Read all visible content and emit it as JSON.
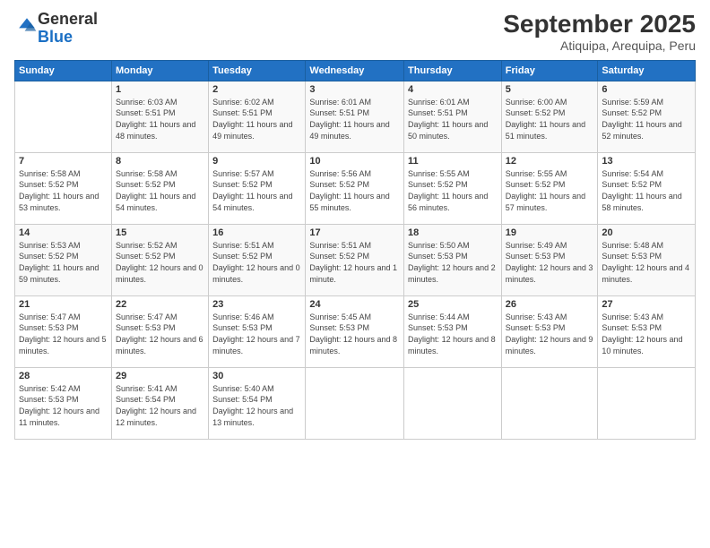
{
  "header": {
    "logo_general": "General",
    "logo_blue": "Blue",
    "title": "September 2025",
    "subtitle": "Atiquipa, Arequipa, Peru"
  },
  "weekdays": [
    "Sunday",
    "Monday",
    "Tuesday",
    "Wednesday",
    "Thursday",
    "Friday",
    "Saturday"
  ],
  "weeks": [
    [
      {
        "day": "",
        "sunrise": "",
        "sunset": "",
        "daylight": ""
      },
      {
        "day": "1",
        "sunrise": "6:03 AM",
        "sunset": "5:51 PM",
        "daylight": "11 hours and 48 minutes."
      },
      {
        "day": "2",
        "sunrise": "6:02 AM",
        "sunset": "5:51 PM",
        "daylight": "11 hours and 49 minutes."
      },
      {
        "day": "3",
        "sunrise": "6:01 AM",
        "sunset": "5:51 PM",
        "daylight": "11 hours and 49 minutes."
      },
      {
        "day": "4",
        "sunrise": "6:01 AM",
        "sunset": "5:51 PM",
        "daylight": "11 hours and 50 minutes."
      },
      {
        "day": "5",
        "sunrise": "6:00 AM",
        "sunset": "5:52 PM",
        "daylight": "11 hours and 51 minutes."
      },
      {
        "day": "6",
        "sunrise": "5:59 AM",
        "sunset": "5:52 PM",
        "daylight": "11 hours and 52 minutes."
      }
    ],
    [
      {
        "day": "7",
        "sunrise": "5:58 AM",
        "sunset": "5:52 PM",
        "daylight": "11 hours and 53 minutes."
      },
      {
        "day": "8",
        "sunrise": "5:58 AM",
        "sunset": "5:52 PM",
        "daylight": "11 hours and 54 minutes."
      },
      {
        "day": "9",
        "sunrise": "5:57 AM",
        "sunset": "5:52 PM",
        "daylight": "11 hours and 54 minutes."
      },
      {
        "day": "10",
        "sunrise": "5:56 AM",
        "sunset": "5:52 PM",
        "daylight": "11 hours and 55 minutes."
      },
      {
        "day": "11",
        "sunrise": "5:55 AM",
        "sunset": "5:52 PM",
        "daylight": "11 hours and 56 minutes."
      },
      {
        "day": "12",
        "sunrise": "5:55 AM",
        "sunset": "5:52 PM",
        "daylight": "11 hours and 57 minutes."
      },
      {
        "day": "13",
        "sunrise": "5:54 AM",
        "sunset": "5:52 PM",
        "daylight": "11 hours and 58 minutes."
      }
    ],
    [
      {
        "day": "14",
        "sunrise": "5:53 AM",
        "sunset": "5:52 PM",
        "daylight": "11 hours and 59 minutes."
      },
      {
        "day": "15",
        "sunrise": "5:52 AM",
        "sunset": "5:52 PM",
        "daylight": "12 hours and 0 minutes."
      },
      {
        "day": "16",
        "sunrise": "5:51 AM",
        "sunset": "5:52 PM",
        "daylight": "12 hours and 0 minutes."
      },
      {
        "day": "17",
        "sunrise": "5:51 AM",
        "sunset": "5:52 PM",
        "daylight": "12 hours and 1 minute."
      },
      {
        "day": "18",
        "sunrise": "5:50 AM",
        "sunset": "5:53 PM",
        "daylight": "12 hours and 2 minutes."
      },
      {
        "day": "19",
        "sunrise": "5:49 AM",
        "sunset": "5:53 PM",
        "daylight": "12 hours and 3 minutes."
      },
      {
        "day": "20",
        "sunrise": "5:48 AM",
        "sunset": "5:53 PM",
        "daylight": "12 hours and 4 minutes."
      }
    ],
    [
      {
        "day": "21",
        "sunrise": "5:47 AM",
        "sunset": "5:53 PM",
        "daylight": "12 hours and 5 minutes."
      },
      {
        "day": "22",
        "sunrise": "5:47 AM",
        "sunset": "5:53 PM",
        "daylight": "12 hours and 6 minutes."
      },
      {
        "day": "23",
        "sunrise": "5:46 AM",
        "sunset": "5:53 PM",
        "daylight": "12 hours and 7 minutes."
      },
      {
        "day": "24",
        "sunrise": "5:45 AM",
        "sunset": "5:53 PM",
        "daylight": "12 hours and 8 minutes."
      },
      {
        "day": "25",
        "sunrise": "5:44 AM",
        "sunset": "5:53 PM",
        "daylight": "12 hours and 8 minutes."
      },
      {
        "day": "26",
        "sunrise": "5:43 AM",
        "sunset": "5:53 PM",
        "daylight": "12 hours and 9 minutes."
      },
      {
        "day": "27",
        "sunrise": "5:43 AM",
        "sunset": "5:53 PM",
        "daylight": "12 hours and 10 minutes."
      }
    ],
    [
      {
        "day": "28",
        "sunrise": "5:42 AM",
        "sunset": "5:53 PM",
        "daylight": "12 hours and 11 minutes."
      },
      {
        "day": "29",
        "sunrise": "5:41 AM",
        "sunset": "5:54 PM",
        "daylight": "12 hours and 12 minutes."
      },
      {
        "day": "30",
        "sunrise": "5:40 AM",
        "sunset": "5:54 PM",
        "daylight": "12 hours and 13 minutes."
      },
      {
        "day": "",
        "sunrise": "",
        "sunset": "",
        "daylight": ""
      },
      {
        "day": "",
        "sunrise": "",
        "sunset": "",
        "daylight": ""
      },
      {
        "day": "",
        "sunrise": "",
        "sunset": "",
        "daylight": ""
      },
      {
        "day": "",
        "sunrise": "",
        "sunset": "",
        "daylight": ""
      }
    ]
  ]
}
